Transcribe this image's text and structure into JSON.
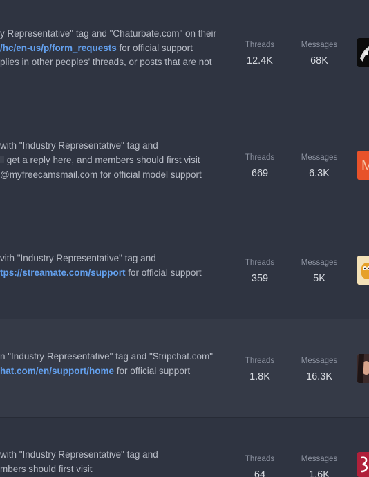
{
  "forums": [
    {
      "desc_lines": [
        {
          "before": "y Representative\" tag and \"Chaturbate.com\" on their",
          "link": "",
          "after": ""
        },
        {
          "before": "",
          "link": "/hc/en-us/p/form_requests",
          "after": " for official support"
        },
        {
          "before": "plies in other peoples' threads, or posts that are not",
          "link": "",
          "after": ""
        }
      ],
      "threads_label": "Threads",
      "threads": "12.4K",
      "messages_label": "Messages",
      "messages": "68K",
      "avatar_icon": "user-avatar-dark",
      "avatar_color": "#111111"
    },
    {
      "desc_lines": [
        {
          "before": "with \"Industry Representative\" tag and",
          "link": "",
          "after": ""
        },
        {
          "before": "ll get a reply here, and members should first visit",
          "link": "",
          "after": ""
        },
        {
          "before": "@myfreecamsmail.com for official model support",
          "link": "",
          "after": ""
        }
      ],
      "threads_label": "Threads",
      "threads": "669",
      "messages_label": "Messages",
      "messages": "6.3K",
      "avatar_icon": "user-avatar-orange",
      "avatar_color": "#e8522a"
    },
    {
      "desc_lines": [
        {
          "before": "vith \"Industry Representative\" tag and",
          "link": "",
          "after": ""
        },
        {
          "before": "",
          "link": "tps://streamate.com/support",
          "after": " for official support"
        }
      ],
      "threads_label": "Threads",
      "threads": "359",
      "messages_label": "Messages",
      "messages": "5K",
      "avatar_icon": "user-avatar-cartoon",
      "avatar_color": "#e6a12a"
    },
    {
      "desc_lines": [
        {
          "before": "n \"Industry Representative\" tag and \"Stripchat.com\"",
          "link": "",
          "after": ""
        },
        {
          "before": "",
          "link": "hat.com/en/support/home",
          "after": " for official support"
        }
      ],
      "threads_label": "Threads",
      "threads": "1.8K",
      "messages_label": "Messages",
      "messages": "16.3K",
      "avatar_icon": "user-avatar-photo",
      "avatar_color": "#8a5a4a"
    },
    {
      "desc_lines": [
        {
          "before": "with \"Industry Representative\" tag and",
          "link": "",
          "after": ""
        },
        {
          "before": "mbers should first visit",
          "link": "",
          "after": ""
        }
      ],
      "threads_label": "Threads",
      "threads": "64",
      "messages_label": "Messages",
      "messages": "1.6K",
      "avatar_icon": "user-avatar-red-logo",
      "avatar_color": "#b0203a"
    }
  ]
}
